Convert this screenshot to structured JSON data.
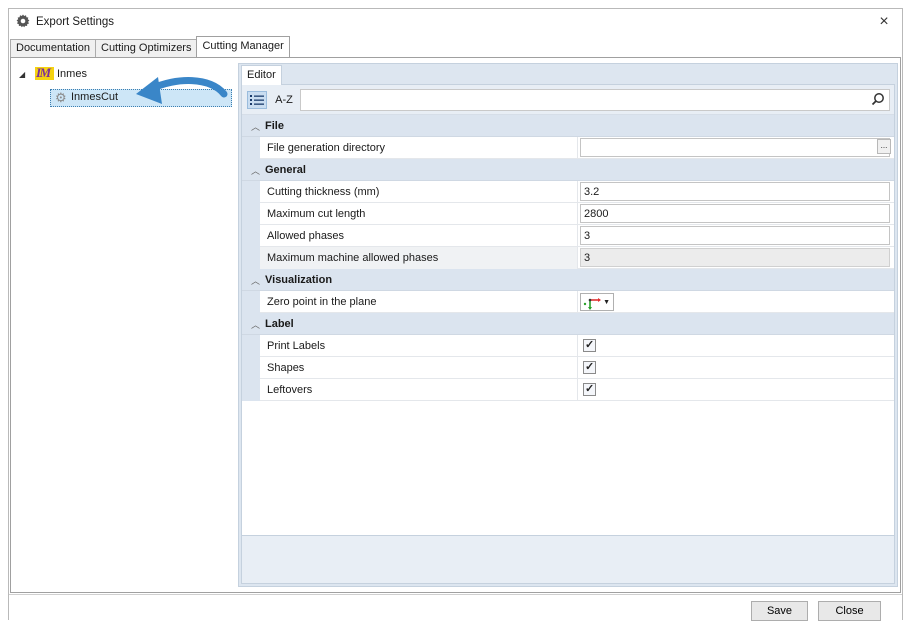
{
  "window": {
    "title": "Export Settings",
    "title_icon": "gear-icon",
    "close_glyph": "×"
  },
  "tabs": [
    {
      "label": "Documentation",
      "active": false
    },
    {
      "label": "Cutting Optimizers",
      "active": false
    },
    {
      "label": "Cutting Manager",
      "active": true
    }
  ],
  "tree": {
    "root": {
      "label": "Inmes",
      "logo_text": "IM",
      "expanded": true
    },
    "child": {
      "label": "InmesCut",
      "selected": true
    }
  },
  "editor": {
    "tab_label": "Editor",
    "toolbar": {
      "categorized_glyph": "⁝☰",
      "alpha_label": "A-Z",
      "search_placeholder": "",
      "search_value": ""
    },
    "categories": {
      "file": {
        "label": "File",
        "rows": [
          {
            "name": "File generation directory",
            "value": "",
            "browse_label": "..."
          }
        ]
      },
      "general": {
        "label": "General",
        "rows": [
          {
            "name": "Cutting thickness (mm)",
            "value": "3.2"
          },
          {
            "name": "Maximum cut length",
            "value": "2800"
          },
          {
            "name": "Allowed phases",
            "value": "3"
          },
          {
            "name": "Maximum machine allowed phases",
            "value": "3",
            "readonly": true
          }
        ]
      },
      "visualization": {
        "label": "Visualization",
        "rows": [
          {
            "name": "Zero point in the plane",
            "value_icon": "origin-axes-icon"
          }
        ]
      },
      "label": {
        "label": "Label",
        "rows": [
          {
            "name": "Print Labels",
            "checked": true
          },
          {
            "name": "Shapes",
            "checked": true
          },
          {
            "name": "Leftovers",
            "checked": true
          }
        ]
      }
    }
  },
  "footer": {
    "save_label": "Save",
    "close_label": "Close"
  },
  "colors": {
    "selection": "#cde6f7",
    "category_bg": "#dbe4ef",
    "panel_bg": "#dde6f0"
  }
}
